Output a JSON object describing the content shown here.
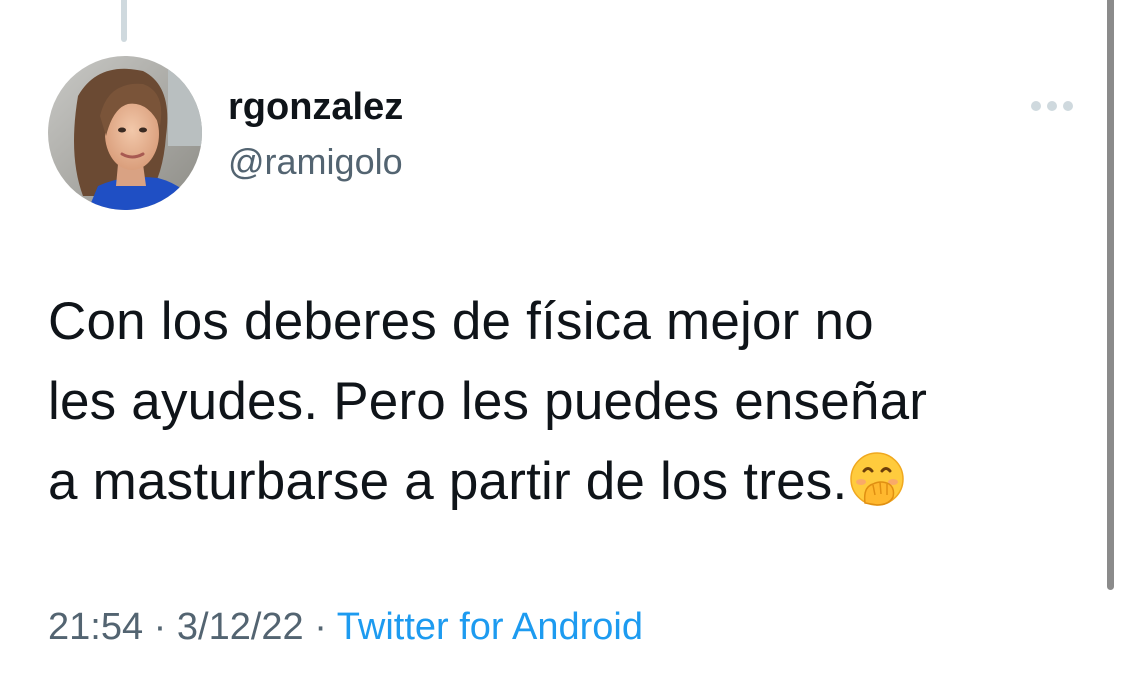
{
  "tweet": {
    "display_name": "rgonzalez",
    "handle": "@ramigolo",
    "text_line1": "Con los deberes de física mejor no",
    "text_line2": "les ayudes. Pero les puedes enseñar",
    "text_line3": "a masturbarse a partir de los tres.",
    "emoji": "face-with-hand-over-mouth",
    "time": "21:54",
    "separator": " · ",
    "date": "3/12/22",
    "source": "Twitter for Android"
  },
  "icons": {
    "more": "more-horizontal-icon",
    "avatar": "profile-photo"
  },
  "colors": {
    "text_primary": "#0f1419",
    "text_secondary": "#536471",
    "link": "#1d9bf0",
    "thread_line": "#cfd9de",
    "more_dots": "#cfd9de"
  }
}
